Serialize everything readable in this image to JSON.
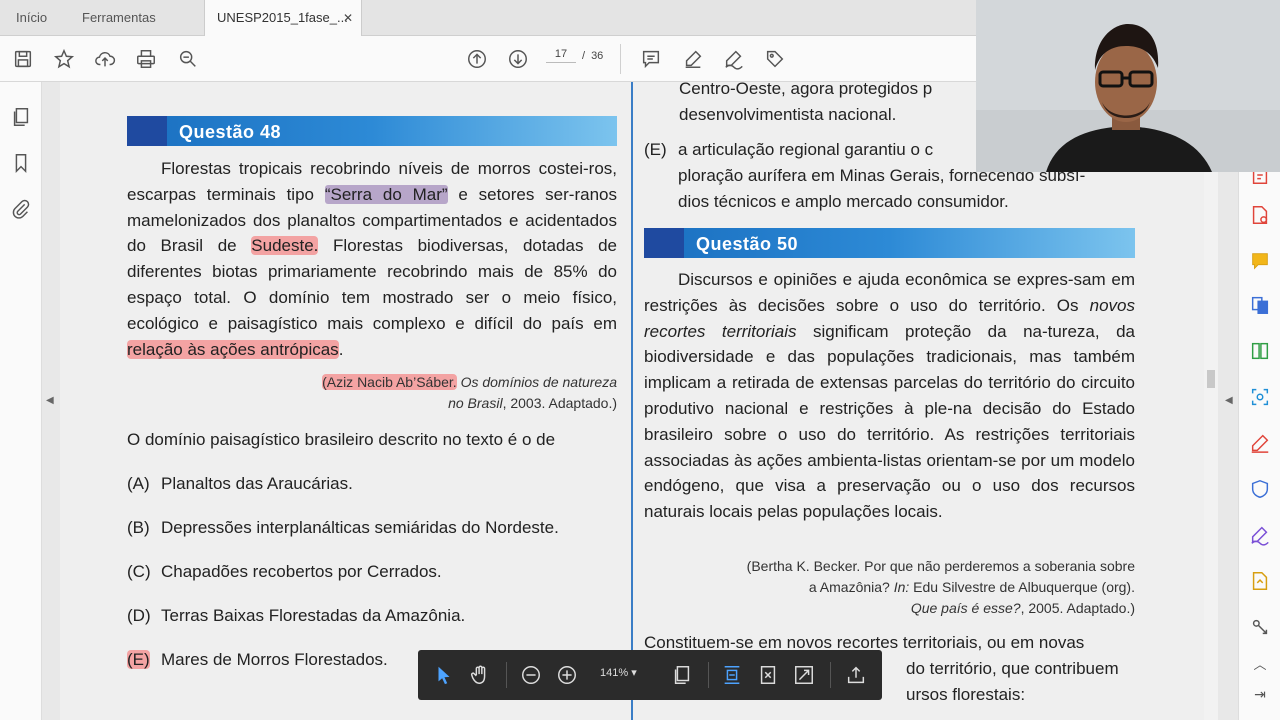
{
  "tabs": [
    {
      "label": "Início"
    },
    {
      "label": "Ferramentas"
    },
    {
      "label": "UNESP2015_1fase_...",
      "close": "✕"
    }
  ],
  "toolbar": {
    "page_current": "17",
    "page_sep": "/",
    "page_total": "36"
  },
  "left_column": {
    "question_title": "Questão 48",
    "text_parts": {
      "p1": "Florestas tropicais recobrindo níveis de morros costei-ros, escarpas terminais tipo ",
      "hl1": "“Serra do Mar”",
      "p2": " e setores ser-ranos mamelonizados dos planaltos compartimentados e acidentados do Brasil de ",
      "hl2": "Sudeste.",
      "p3": " Florestas biodiversas, dotadas de diferentes biotas primariamente recobrindo mais de 85% do espaço total. O domínio tem mostrado ser o meio físico, ecológico e paisagístico mais complexo e difícil do país em ",
      "hl3": "relação às ações antrópicas",
      "p4": "."
    },
    "citation": {
      "author": "(Aziz Nacib Ab’Sáber.",
      "work": " Os domínios de natureza",
      "line2_italic": "no Brasil",
      "line2_rest": ", 2003. Adaptado.)"
    },
    "prompt": "O domínio paisagístico brasileiro descrito no texto é o de",
    "options": [
      {
        "letter": "(A)",
        "text": "Planaltos das Araucárias."
      },
      {
        "letter": "(B)",
        "text": "Depressões interplanálticas semiáridas do Nordeste."
      },
      {
        "letter": "(C)",
        "text": "Chapadões recobertos por Cerrados."
      },
      {
        "letter": "(D)",
        "text": "Terras Baixas Florestadas da Amazônia."
      },
      {
        "letter": "(E)",
        "text": "Mares de Morros Florestados."
      }
    ]
  },
  "right_column": {
    "top_line1": "Centro-Oeste, agora protegidos p",
    "top_line2": "desenvolvimentista nacional.",
    "option_e": {
      "letter": "(E)",
      "line1": "a articulação regional garantiu o c",
      "line2": "ploração aurífera em Minas Gerais, fornecendo subsí-",
      "line3": "dios técnicos e amplo mercado consumidor."
    },
    "question_title": "Questão 50",
    "text_parts": {
      "p1": "Discursos e opiniões e ajuda econômica se expres-sam em restrições às decisões sobre o uso do território. Os ",
      "italic": "novos recortes territoriais",
      "p2": " significam proteção da na-tureza, da biodiversidade e das populações tradicionais, mas também implicam a retirada de extensas parcelas do território do circuito produtivo nacional e restrições à ple-na decisão do Estado brasileiro sobre o uso do território. As restrições territoriais associadas às ações ambienta-listas orientam-se por um modelo endógeno, que visa a preservação ou o uso dos recursos naturais locais pelas populações locais."
    },
    "citation": {
      "line1": "(Bertha K. Becker. Por que não perderemos a soberania sobre",
      "line2a": "a Amazônia? ",
      "line2b": "In:",
      "line2c": " Edu Silvestre de Albuquerque (org).",
      "line3a": "Que país é esse?",
      "line3b": ", 2005. Adaptado.)"
    },
    "prompt_line1": "Constituem-se em novos recortes territoriais, ou em novas",
    "prompt_line2": "do território, que contribuem",
    "prompt_line3": "ursos florestais:"
  },
  "floatbar": {
    "zoom": "141%"
  },
  "colors": {
    "accent_blue": "#2d8ad6",
    "highlight_red": "#f3a3a3",
    "highlight_purple": "#b7a6c9"
  }
}
